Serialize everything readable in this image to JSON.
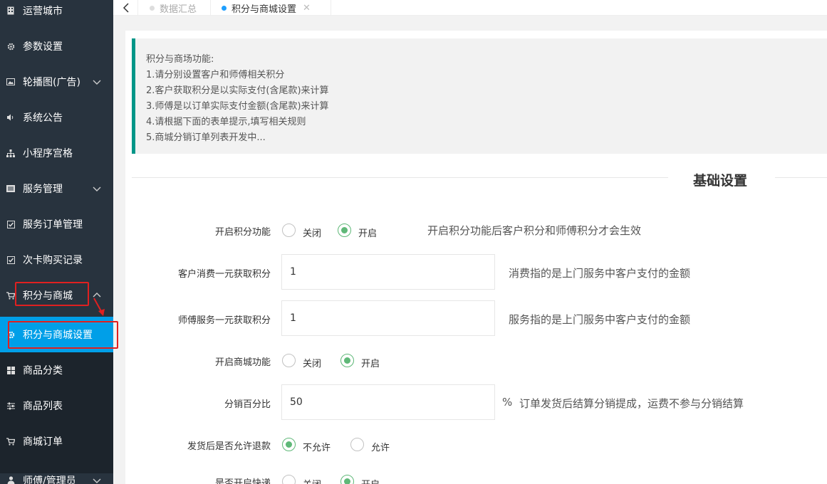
{
  "sidebar": {
    "items": [
      {
        "label": "运营城市",
        "icon": "building-icon"
      },
      {
        "label": "参数设置",
        "icon": "gear-icon"
      },
      {
        "label": "轮播图(广告)",
        "icon": "image-icon"
      },
      {
        "label": "系统公告",
        "icon": "speaker-icon"
      },
      {
        "label": "小程序宫格",
        "icon": "sitemap-icon"
      },
      {
        "label": "服务管理",
        "icon": "list-icon"
      },
      {
        "label": "服务订单管理",
        "icon": "check-square-icon"
      },
      {
        "label": "次卡购买记录",
        "icon": "check-square-icon"
      },
      {
        "label": "积分与商城",
        "icon": "cart-icon"
      }
    ],
    "subitems": [
      {
        "label": "积分与商城设置",
        "icon": "gear-icon"
      },
      {
        "label": "商品分类",
        "icon": "grid-icon"
      },
      {
        "label": "商品列表",
        "icon": "sliders-icon"
      },
      {
        "label": "商城订单",
        "icon": "cart-icon"
      }
    ],
    "bottom_item": {
      "label": "师傅/管理员",
      "icon": "user-icon"
    }
  },
  "tabs": [
    {
      "label": "数据汇总",
      "active": false
    },
    {
      "label": "积分与商城设置",
      "active": true
    }
  ],
  "notice": {
    "title": "积分与商场功能:",
    "lines": [
      "1.请分别设置客户和师傅相关积分",
      "2.客户获取积分是以实际支付(含尾款)来计算",
      "3.师傅是以订单实际支付金额(含尾款)来计算",
      "4.请根据下面的表单提示,填写相关规则",
      "5.商城分销订单列表开发中..."
    ]
  },
  "section_title": "基础设置",
  "form": {
    "points_enable": {
      "label": "开启积分功能",
      "off": "关闭",
      "on": "开启",
      "hint": "开启积分功能后客户积分和师傅积分才会生效"
    },
    "customer_points": {
      "label": "客户消费一元获取积分",
      "value": "1",
      "hint": "消费指的是上门服务中客户支付的金额"
    },
    "master_points": {
      "label": "师傅服务一元获取积分",
      "value": "1",
      "hint": "服务指的是上门服务中客户支付的金额"
    },
    "mall_enable": {
      "label": "开启商城功能",
      "off": "关闭",
      "on": "开启"
    },
    "distribution": {
      "label": "分销百分比",
      "value": "50",
      "unit": "%",
      "hint": "订单发货后结算分销提成，运费不参与分销结算"
    },
    "refund": {
      "label": "发货后是否允许退款",
      "no": "不允许",
      "yes": "允许"
    },
    "express": {
      "label": "是否开启快递",
      "off": "关闭",
      "on": "开启"
    }
  },
  "colors": {
    "sidebar_bg": "#28333e",
    "active_bg": "#009fe8",
    "accent_green": "#5fb878",
    "notice_border": "#009688",
    "annotation_red": "#e02020"
  }
}
